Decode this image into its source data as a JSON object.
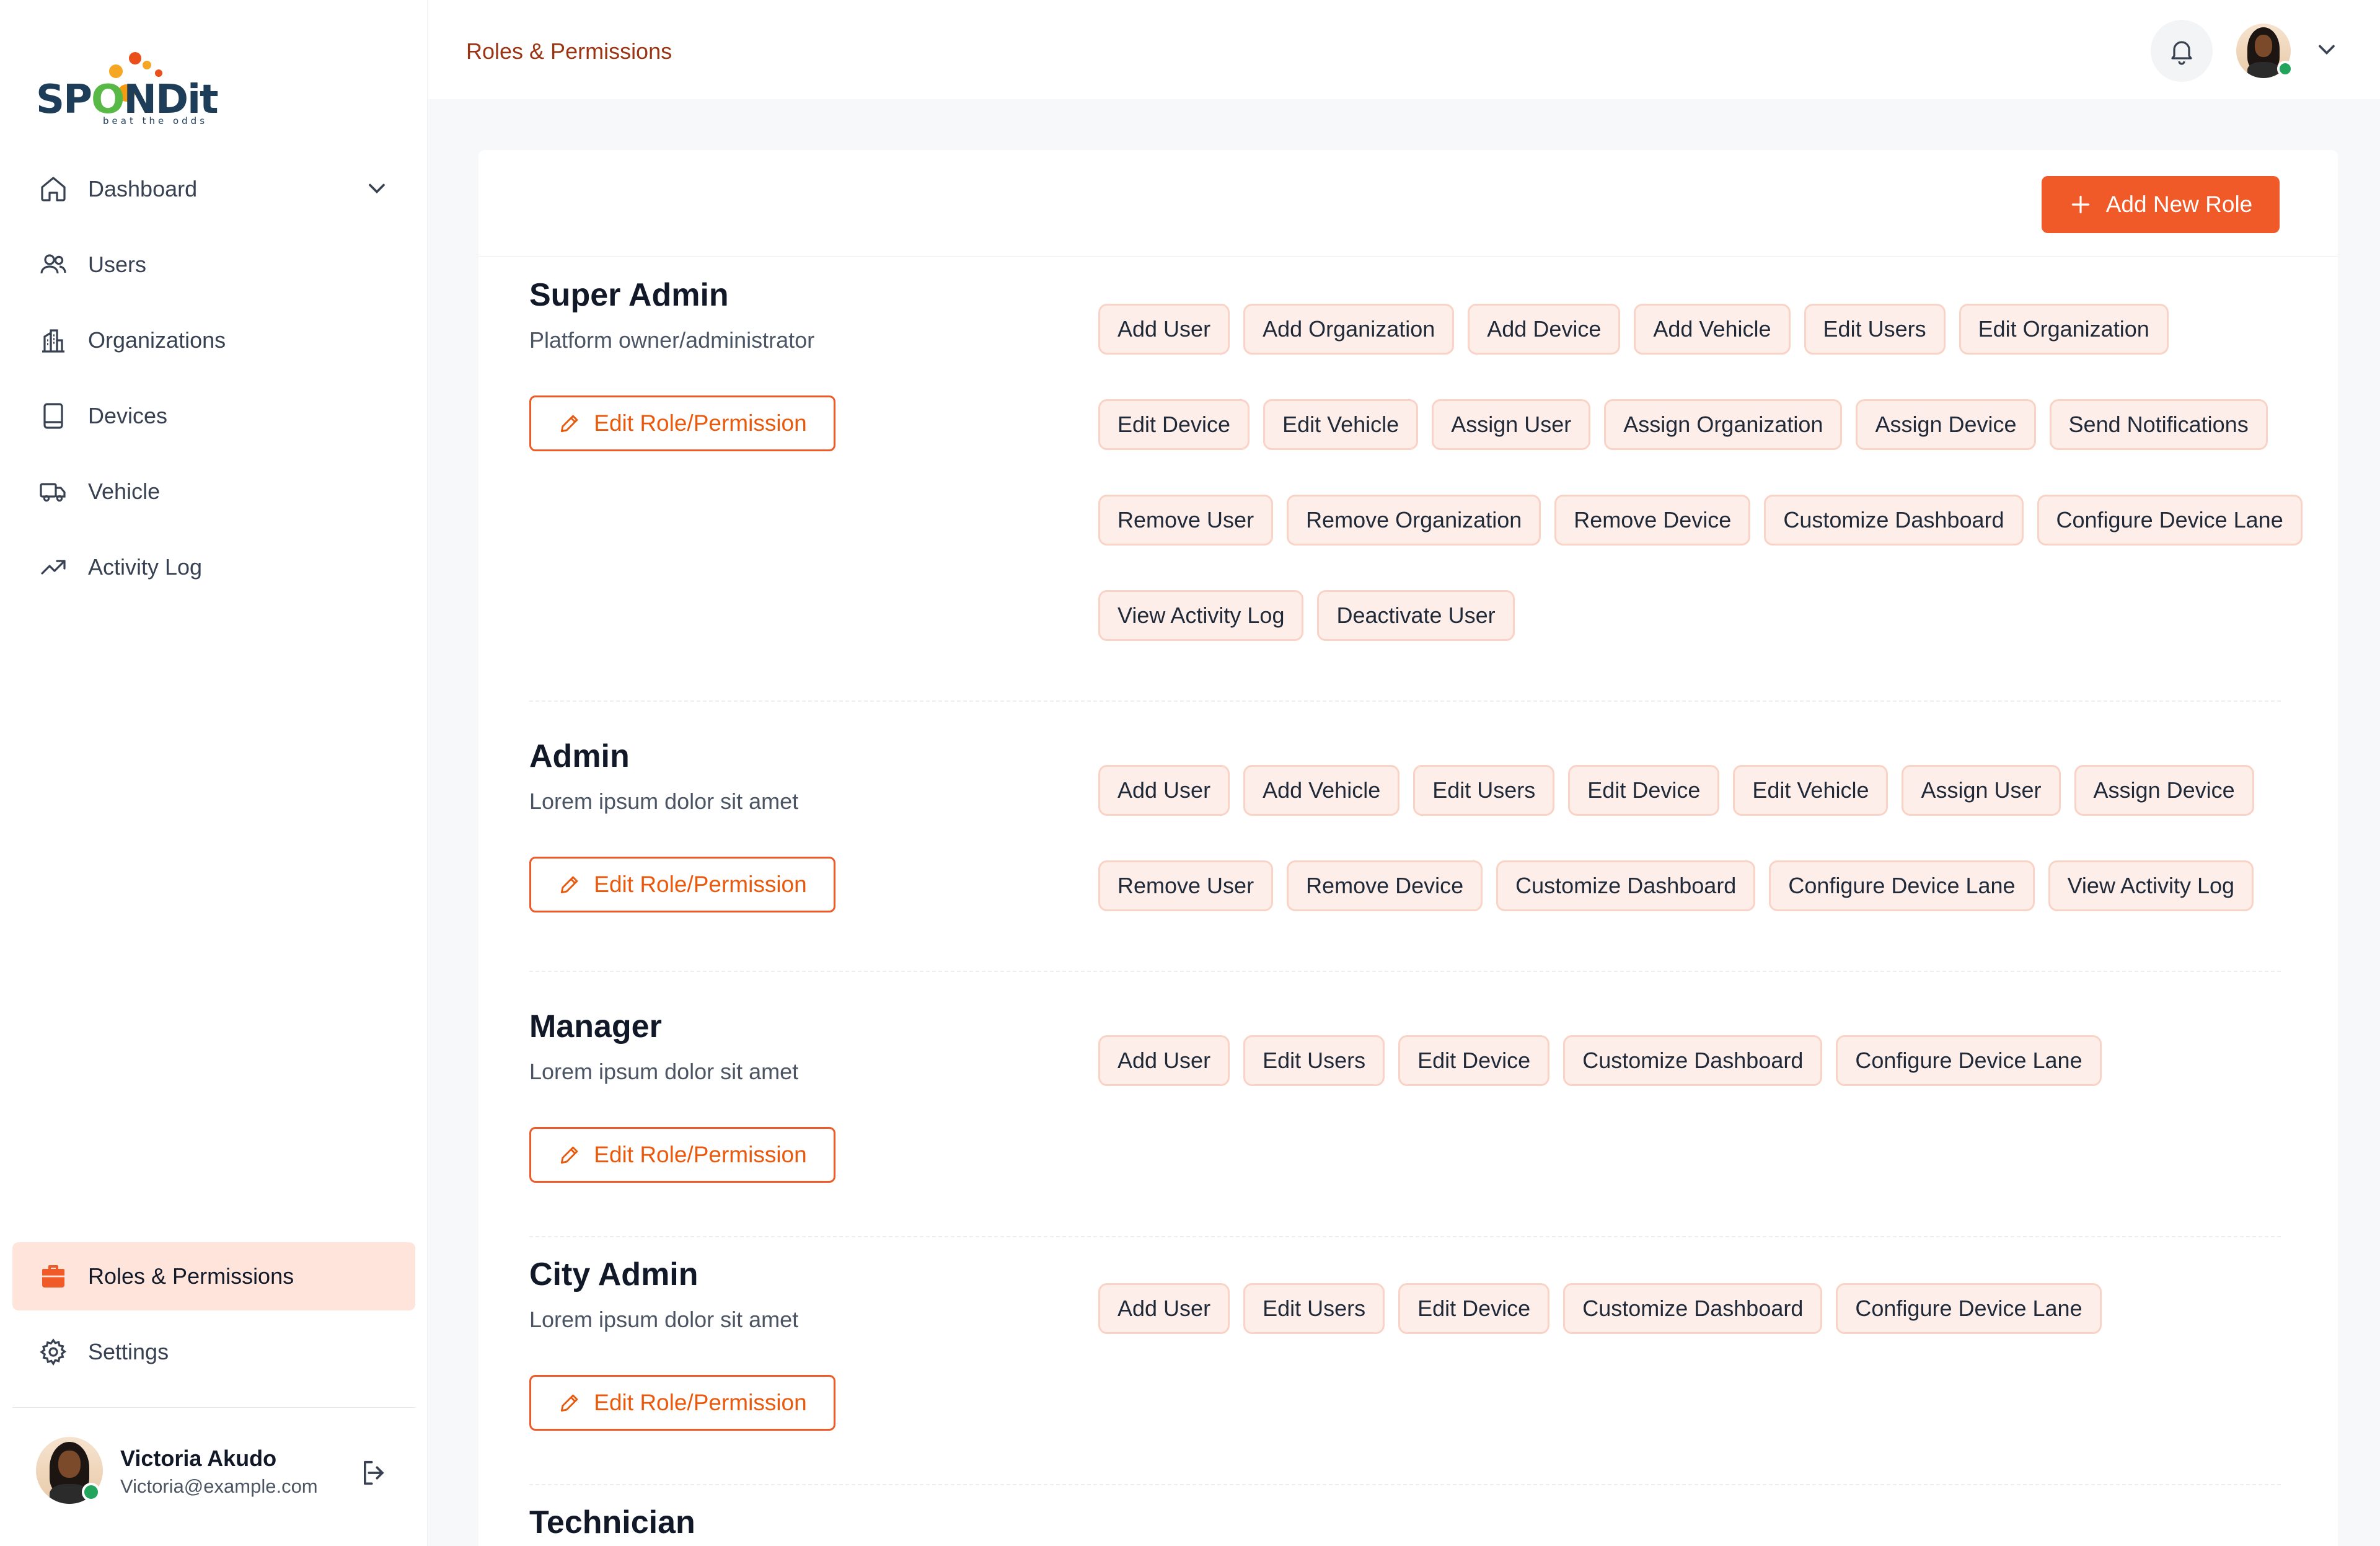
{
  "brand": {
    "name_part1": "SP",
    "name_o": "O",
    "name_part2": "NDit",
    "tagline": "beat the odds"
  },
  "sidebar": {
    "items": [
      {
        "label": "Dashboard",
        "icon": "home-icon",
        "has_chevron": true
      },
      {
        "label": "Users",
        "icon": "users-icon"
      },
      {
        "label": "Organizations",
        "icon": "building-icon"
      },
      {
        "label": "Devices",
        "icon": "device-icon"
      },
      {
        "label": "Vehicle",
        "icon": "truck-icon"
      },
      {
        "label": "Activity Log",
        "icon": "trend-icon"
      }
    ],
    "bottom_items": [
      {
        "label": "Roles & Permissions",
        "icon": "briefcase-icon",
        "active": true
      },
      {
        "label": "Settings",
        "icon": "gear-icon"
      }
    ]
  },
  "user": {
    "name": "Victoria Akudo",
    "email": "Victoria@example.com"
  },
  "header": {
    "title": "Roles & Permissions"
  },
  "toolbar": {
    "add_role_label": "Add New Role"
  },
  "edit_label": "Edit Role/Permission",
  "roles": [
    {
      "title": "Super Admin",
      "description": "Platform owner/administrator",
      "permissions": [
        "Add User",
        "Add Organization",
        "Add Device",
        "Add Vehicle",
        "Edit Users",
        "Edit Organization",
        "Edit Device",
        "Edit Vehicle",
        "Assign User",
        "Assign Organization",
        "Assign Device",
        "Send Notifications",
        "Remove User",
        "Remove Organization",
        "Remove Device",
        "Customize Dashboard",
        "Configure Device Lane",
        "View Activity Log",
        "Deactivate User"
      ]
    },
    {
      "title": "Admin",
      "description": "Lorem ipsum dolor sit amet",
      "permissions": [
        "Add User",
        "Add Vehicle",
        "Edit Users",
        "Edit Device",
        "Edit Vehicle",
        "Assign User",
        "Assign Device",
        "Remove User",
        "Remove Device",
        "Customize Dashboard",
        "Configure Device Lane",
        "View Activity Log"
      ]
    },
    {
      "title": "Manager",
      "description": "Lorem ipsum dolor sit amet",
      "permissions": [
        "Add User",
        "Edit Users",
        "Edit Device",
        "Customize Dashboard",
        "Configure Device Lane"
      ]
    },
    {
      "title": "City Admin",
      "description": "Lorem ipsum dolor sit amet",
      "permissions": [
        "Add User",
        "Edit Users",
        "Edit Device",
        "Customize Dashboard",
        "Configure Device Lane"
      ]
    },
    {
      "title": "Technician",
      "description": "",
      "permissions": [
        "",
        "",
        "",
        "",
        ""
      ]
    }
  ],
  "colors": {
    "accent": "#f05a28",
    "chip_bg": "#fdeeea",
    "chip_border": "#f8d3c6",
    "active_bg": "#ffe4dc"
  }
}
